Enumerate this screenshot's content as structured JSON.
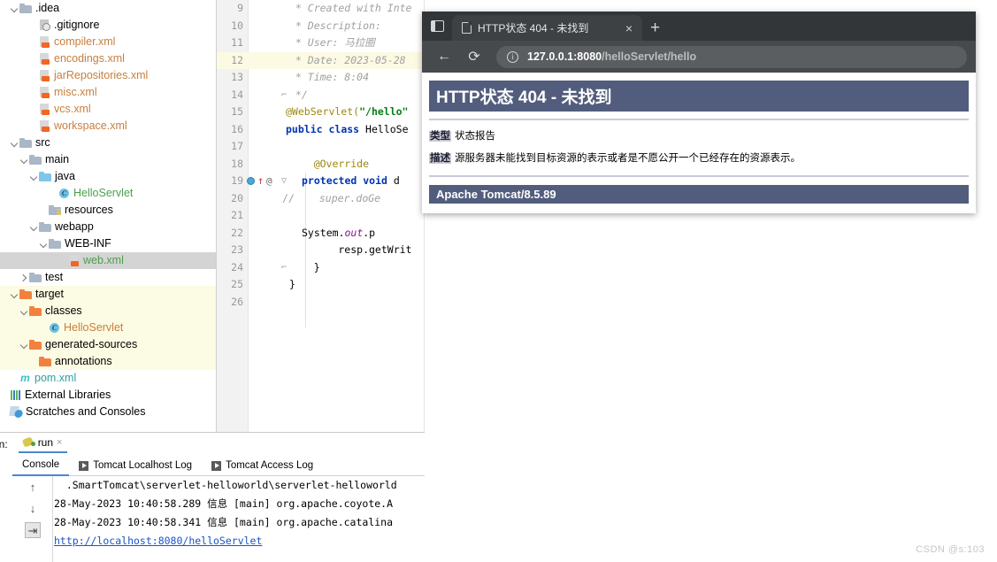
{
  "ide": {
    "project_tree": [
      {
        "label": ".idea",
        "indent": 1,
        "arrow": "open",
        "icon": "folder-icon",
        "color": "dark",
        "state": "normal"
      },
      {
        "label": ".gitignore",
        "indent": 3,
        "arrow": "none",
        "icon": "gitignore-icon",
        "color": "dark",
        "state": "normal"
      },
      {
        "label": "compiler.xml",
        "indent": 3,
        "arrow": "none",
        "icon": "xml-file-icon",
        "color": "orange",
        "state": "normal"
      },
      {
        "label": "encodings.xml",
        "indent": 3,
        "arrow": "none",
        "icon": "xml-file-icon",
        "color": "orange",
        "state": "normal"
      },
      {
        "label": "jarRepositories.xml",
        "indent": 3,
        "arrow": "none",
        "icon": "xml-file-icon",
        "color": "orange",
        "state": "normal"
      },
      {
        "label": "misc.xml",
        "indent": 3,
        "arrow": "none",
        "icon": "xml-file-icon",
        "color": "orange",
        "state": "normal"
      },
      {
        "label": "vcs.xml",
        "indent": 3,
        "arrow": "none",
        "icon": "xml-file-icon",
        "color": "orange",
        "state": "normal"
      },
      {
        "label": "workspace.xml",
        "indent": 3,
        "arrow": "none",
        "icon": "xml-file-icon",
        "color": "orange",
        "state": "normal"
      },
      {
        "label": "src",
        "indent": 1,
        "arrow": "open",
        "icon": "folder-icon",
        "color": "dark",
        "state": "normal"
      },
      {
        "label": "main",
        "indent": 2,
        "arrow": "open",
        "icon": "folder-icon",
        "color": "dark",
        "state": "normal"
      },
      {
        "label": "java",
        "indent": 3,
        "arrow": "open",
        "icon": "source-folder-icon",
        "color": "dark",
        "state": "normal"
      },
      {
        "label": "HelloServlet",
        "indent": 5,
        "arrow": "none",
        "icon": "java-class-icon",
        "color": "green",
        "state": "normal"
      },
      {
        "label": "resources",
        "indent": 4,
        "arrow": "none",
        "icon": "resources-folder-icon",
        "color": "dark",
        "state": "normal"
      },
      {
        "label": "webapp",
        "indent": 3,
        "arrow": "open",
        "icon": "folder-icon",
        "color": "dark",
        "state": "normal"
      },
      {
        "label": "WEB-INF",
        "indent": 4,
        "arrow": "open",
        "icon": "folder-icon",
        "color": "dark",
        "state": "normal"
      },
      {
        "label": "web.xml",
        "indent": 6,
        "arrow": "none",
        "icon": "xml-file-icon",
        "color": "green",
        "state": "selected"
      },
      {
        "label": "test",
        "indent": 2,
        "arrow": "closed",
        "icon": "folder-icon",
        "color": "dark",
        "state": "normal"
      },
      {
        "label": "target",
        "indent": 1,
        "arrow": "open",
        "icon": "excluded-folder-icon",
        "color": "dark",
        "state": "excluded"
      },
      {
        "label": "classes",
        "indent": 2,
        "arrow": "open",
        "icon": "excluded-folder-icon",
        "color": "dark",
        "state": "excluded"
      },
      {
        "label": "HelloServlet",
        "indent": 4,
        "arrow": "none",
        "icon": "java-class-icon",
        "color": "orange",
        "state": "excluded"
      },
      {
        "label": "generated-sources",
        "indent": 2,
        "arrow": "open",
        "icon": "excluded-folder-icon",
        "color": "dark",
        "state": "excluded"
      },
      {
        "label": "annotations",
        "indent": 3,
        "arrow": "none",
        "icon": "excluded-folder-icon",
        "color": "dark",
        "state": "excluded"
      },
      {
        "label": "pom.xml",
        "indent": 1,
        "arrow": "none",
        "icon": "maven-icon",
        "color": "teal",
        "state": "normal"
      },
      {
        "label": "External Libraries",
        "indent": 0,
        "arrow": "none",
        "icon": "library-icon",
        "color": "dark",
        "state": "normal"
      },
      {
        "label": "Scratches and Consoles",
        "indent": 0,
        "arrow": "none",
        "icon": "scratches-icon",
        "color": "dark",
        "state": "normal"
      }
    ],
    "editor": {
      "lines": [
        {
          "num": "9",
          "text": " * Created with Inte",
          "style": "cmt",
          "caret": false
        },
        {
          "num": "10",
          "text": " * Description:",
          "style": "cmt",
          "caret": false
        },
        {
          "num": "11",
          "text": " * User: 马拉圈",
          "style": "cmt",
          "caret": false
        },
        {
          "num": "12",
          "text": " * Date: 2023-05-28",
          "style": "cmt",
          "caret": true
        },
        {
          "num": "13",
          "text": " * Time: 8:04",
          "style": "cmt",
          "caret": false
        },
        {
          "num": "14",
          "text": " */",
          "style": "cmt",
          "caret": false,
          "fold": "end"
        },
        {
          "num": "15",
          "text": "",
          "style": "mix-annotation",
          "caret": false
        },
        {
          "num": "16",
          "text": "",
          "style": "mix-class",
          "caret": false
        },
        {
          "num": "17",
          "text": "",
          "style": "pln",
          "caret": false
        },
        {
          "num": "18",
          "text": "    @Override",
          "style": "ann",
          "caret": false
        },
        {
          "num": "19",
          "text": "",
          "style": "mix-method",
          "caret": false,
          "marker": "breakpoint-override",
          "fold": "open"
        },
        {
          "num": "20",
          "text": "",
          "style": "mix-comment-code",
          "caret": false
        },
        {
          "num": "21",
          "text": "",
          "style": "pln",
          "caret": false
        },
        {
          "num": "22",
          "text": "",
          "style": "mix-sysout",
          "caret": false
        },
        {
          "num": "23",
          "text": "        resp.getWrit",
          "style": "pln",
          "caret": false
        },
        {
          "num": "24",
          "text": "    }",
          "style": "pln",
          "caret": false,
          "fold": "end"
        },
        {
          "num": "25",
          "text": "}",
          "style": "pln",
          "caret": false
        },
        {
          "num": "26",
          "text": "",
          "style": "pln",
          "caret": false
        }
      ],
      "line15": {
        "annotation": "@WebServlet(",
        "string": "\"/hello\"",
        "tail": ""
      },
      "line16": {
        "kw1": "public",
        "kw2": "class",
        "name": "HelloSe"
      },
      "line19": {
        "kw1": "protected",
        "kw2": "void",
        "name": "d"
      },
      "line20": {
        "comment_marker": "//",
        "body": "super.doGe"
      },
      "line22": {
        "head": "System.",
        "field": "out",
        "tail": ".p"
      }
    },
    "run_window": {
      "run_label": "un:",
      "run_tab_label": "run",
      "tabs": [
        {
          "label": "Console",
          "icon": "none",
          "active": true
        },
        {
          "label": "Tomcat Localhost Log",
          "icon": "play-icon",
          "active": false
        },
        {
          "label": "Tomcat Access Log",
          "icon": "play-icon",
          "active": false
        }
      ],
      "side_buttons": [
        {
          "name": "scroll-up-button",
          "glyph": "↑"
        },
        {
          "name": "scroll-down-button",
          "glyph": "↓"
        },
        {
          "name": "soft-wrap-button",
          "glyph": "⇥"
        }
      ],
      "console_lines": [
        {
          "text": "  .SmartTomcat\\serverlet-helloworld\\serverlet-helloworld",
          "link": false
        },
        {
          "text": "28-May-2023 10:40:58.289 信息 [main] org.apache.coyote.A",
          "link": false
        },
        {
          "text": "28-May-2023 10:40:58.341 信息 [main] org.apache.catalina",
          "link": false
        },
        {
          "text": "http://localhost:8080/helloServlet",
          "link": true
        }
      ]
    }
  },
  "browser": {
    "tab": {
      "title": "HTTP状态 404 - 未找到",
      "close_glyph": "×",
      "new_tab_glyph": "+"
    },
    "toolbar": {
      "back_glyph": "←",
      "reload_glyph": "⟳",
      "info_glyph": "i",
      "url_host": "127.0.0.1:8080",
      "url_path": "/helloServlet/hello"
    },
    "page": {
      "heading": "HTTP状态 404 - 未找到",
      "type_key": "类型",
      "type_value": "状态报告",
      "desc_key": "描述",
      "desc_value": "源服务器未能找到目标资源的表示或者是不愿公开一个已经存在的资源表示。",
      "footer": "Apache Tomcat/8.5.89"
    }
  },
  "watermark": "CSDN @s:103",
  "colors": {
    "tomcat_header": "#525d7d",
    "accent_blue": "#4a88c7",
    "excluded_bg": "#fcfbe3",
    "selected_bg": "#d4d4d4",
    "browser_chrome": "#323639",
    "browser_toolbar": "#474a4d"
  }
}
